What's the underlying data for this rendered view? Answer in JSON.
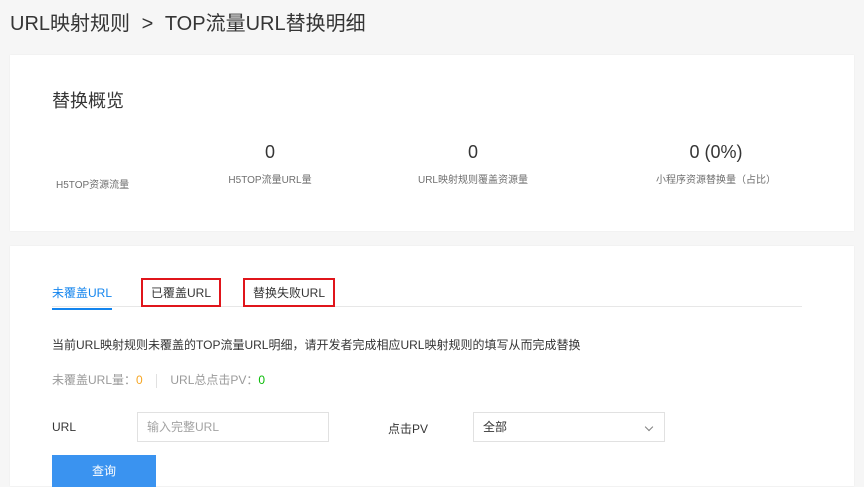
{
  "breadcrumb": {
    "parent": "URL映射规则",
    "separator": ">",
    "current": "TOP流量URL替换明细"
  },
  "overview": {
    "title": "替换概览",
    "first_label": "H5TOP资源流量",
    "stats": [
      {
        "value": "0",
        "label": "H5TOP流量URL量"
      },
      {
        "value": "0",
        "label": "URL映射规则覆盖资源量"
      },
      {
        "value": "0 (0%)",
        "label": "小程序资源替换量（占比）"
      }
    ]
  },
  "tabs": [
    {
      "label": "未覆盖URL",
      "active": true
    },
    {
      "label": "已覆盖URL",
      "active": false
    },
    {
      "label": "替换失败URL",
      "active": false
    }
  ],
  "description": "当前URL映射规则未覆盖的TOP流量URL明细，请开发者完成相应URL映射规则的填写从而完成替换",
  "counts": {
    "uncovered_label": "未覆盖URL量：",
    "uncovered_value": "0",
    "pv_label": "URL总点击PV：",
    "pv_value": "0"
  },
  "form": {
    "url_label": "URL",
    "url_placeholder": "输入完整URL",
    "url_value": "",
    "pv_label": "点击PV",
    "pv_selected": "全部",
    "submit_label": "查询"
  },
  "colors": {
    "accent": "#1485ee",
    "highlight_box": "#e0151b",
    "orange": "#f6a623",
    "green": "#09bb07"
  }
}
